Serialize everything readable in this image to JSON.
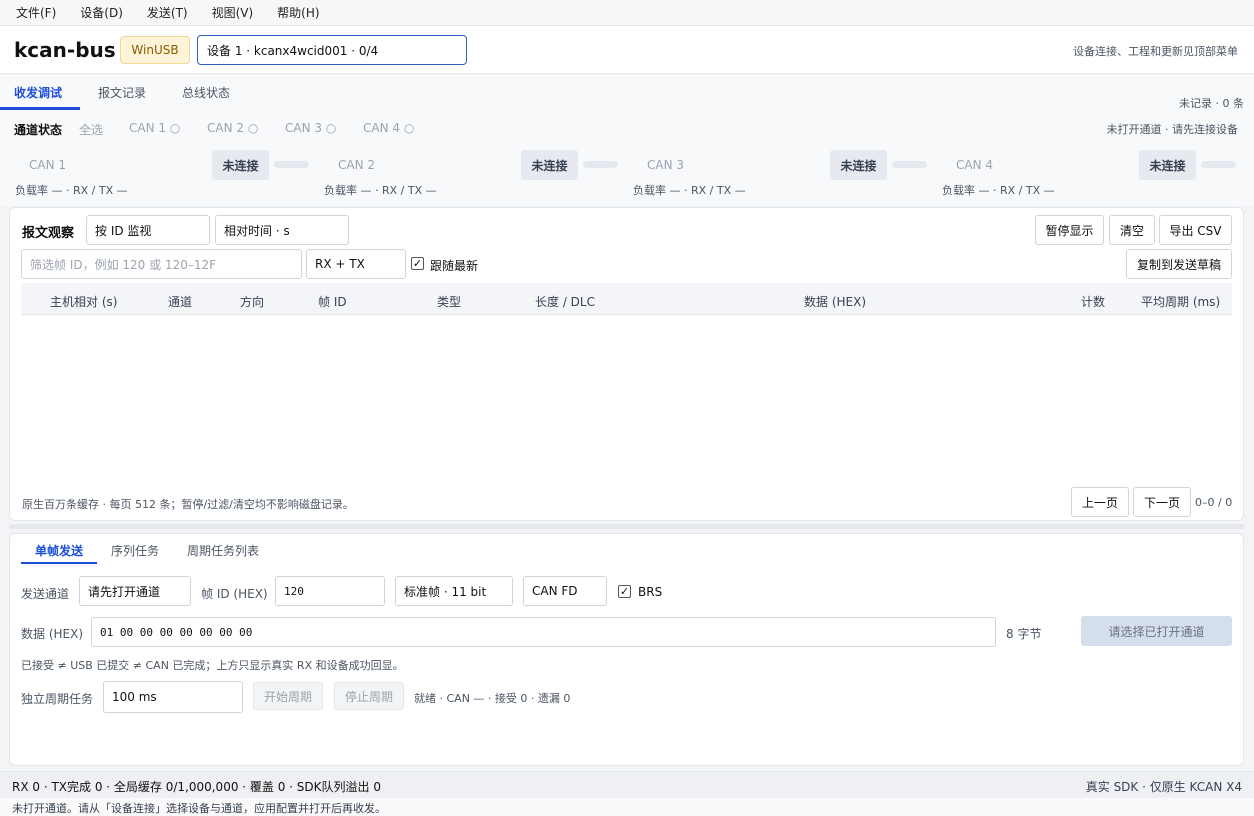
{
  "menu": [
    "文件(F)",
    "设备(D)",
    "发送(T)",
    "视图(V)",
    "帮助(H)"
  ],
  "header": {
    "title": "kcan-bus",
    "driver_badge": "WinUSB",
    "device_value": "设备 1 · kcanx4wcid001 · 0/4",
    "hint": "设备连接、工程和更新见顶部菜单"
  },
  "tabs": {
    "items": [
      "收发调试",
      "报文记录",
      "总线状态"
    ],
    "active": "收发调试",
    "record_count": "未记录 · 0 条"
  },
  "channels": {
    "title": "通道状态",
    "select_all": "全选",
    "chips": [
      "CAN 1 ○",
      "CAN 2 ○",
      "CAN 3 ○",
      "CAN 4 ○"
    ],
    "hint": "未打开通道 · 请先连接设备",
    "cards": [
      {
        "name": "CAN 1",
        "status": "未连接",
        "load": "负载率 — · RX / TX —"
      },
      {
        "name": "CAN 2",
        "status": "未连接",
        "load": "负载率 — · RX / TX —"
      },
      {
        "name": "CAN 3",
        "status": "未连接",
        "load": "负载率 — · RX / TX —"
      },
      {
        "name": "CAN 4",
        "status": "未连接",
        "load": "负载率 — · RX / TX —"
      }
    ]
  },
  "monitor": {
    "title": "报文观察",
    "mode_select": "按 ID 监视",
    "time_select": "相对时间 · s",
    "pause_button": "暂停显示",
    "clear_button": "清空",
    "export_button": "导出 CSV",
    "filter_placeholder": "筛选帧 ID，例如 120 或 120–12F",
    "direction_select": "RX + TX",
    "follow_label": "跟随最新",
    "follow_checked": "✓",
    "copy_button": "复制到发送草稿",
    "columns": [
      "主机相对 (s)",
      "通道",
      "方向",
      "帧 ID",
      "类型",
      "长度 / DLC",
      "数据 (HEX)",
      "计数",
      "平均周期 (ms)"
    ],
    "footer": "原生百万条缓存 · 每页 512 条；暂停/过滤/清空均不影响磁盘记录。",
    "prev_button": "上一页",
    "next_button": "下一页",
    "page_info": "0–0 / 0"
  },
  "send": {
    "tabs": [
      "单帧发送",
      "序列任务",
      "周期任务列表"
    ],
    "channel_label": "发送通道",
    "channel_value": "请先打开通道",
    "id_label": "帧 ID (HEX)",
    "id_value": "120",
    "frame_type": "标准帧 · 11 bit",
    "protocol": "CAN FD",
    "brs_label": "BRS",
    "brs_checked": "✓",
    "data_label": "数据 (HEX)",
    "data_value": "01 00 00 00 00 00 00 00",
    "byte_count": "8 字节",
    "send_button": "请选择已打开通道",
    "note": "已接受 ≠ USB 已提交 ≠ CAN 已完成；上方只显示真实 RX 和设备成功回显。",
    "period_label": "独立周期任务",
    "period_value": "100 ms",
    "start_button": "开始周期",
    "stop_button": "停止周期",
    "period_status": "就绪 · CAN — · 接受 0 · 遗漏 0"
  },
  "status": {
    "left": "RX 0 · TX完成 0 · 全局缓存 0/1,000,000 · 覆盖 0 · SDK队列溢出 0",
    "right": "真实 SDK · 仅原生 KCAN X4",
    "hint": "未打开通道。请从「设备连接」选择设备与通道，应用配置并打开后再收发。"
  }
}
